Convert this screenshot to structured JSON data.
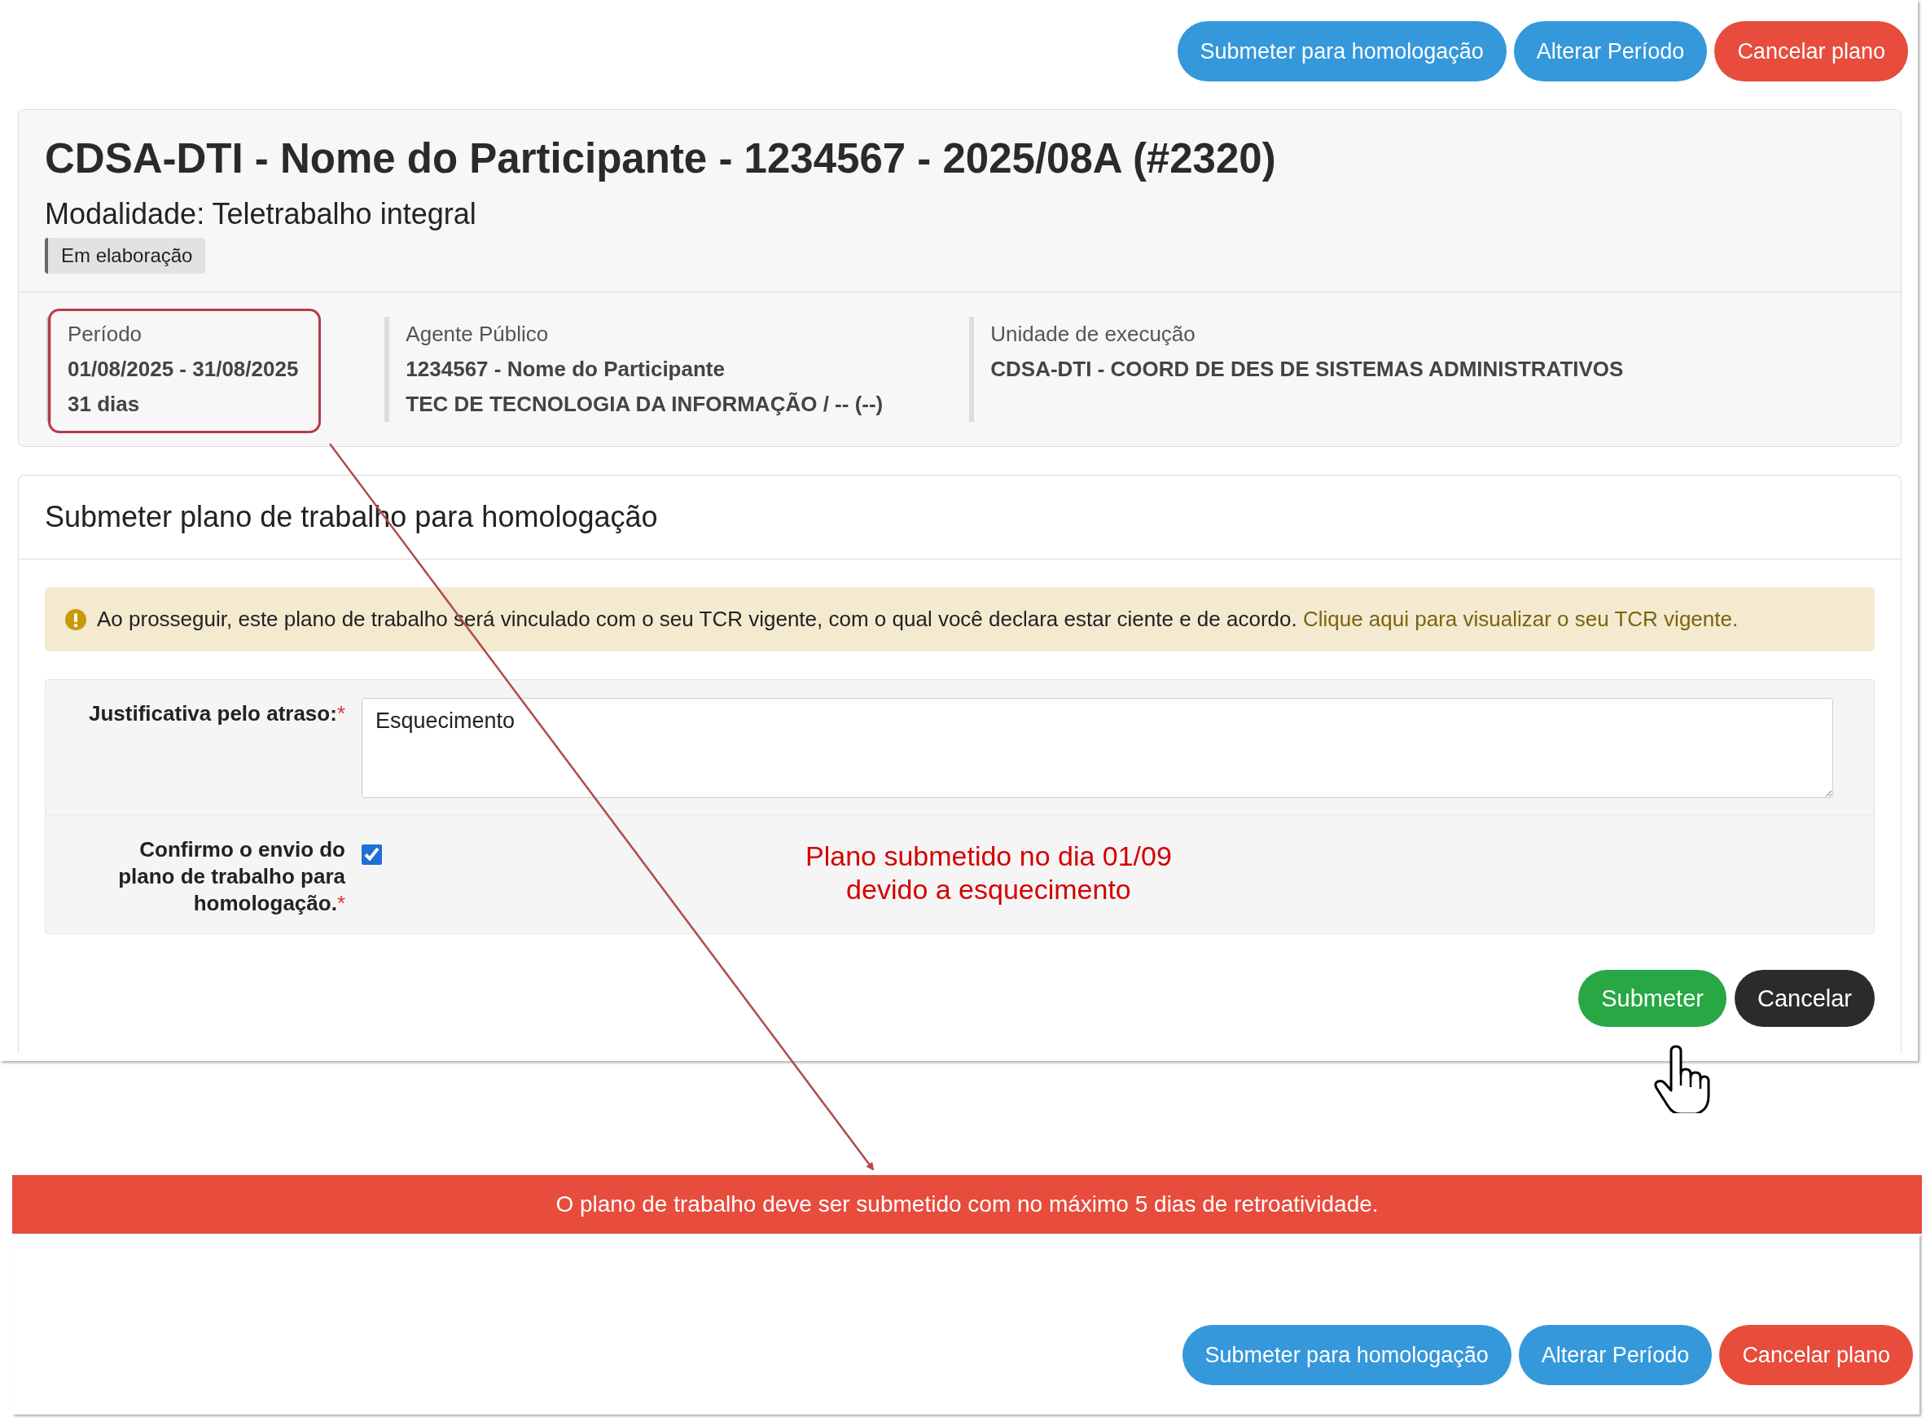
{
  "top_actions": [
    {
      "label": "Submeter para homologação",
      "kind": "primary"
    },
    {
      "label": "Alterar Período",
      "kind": "primary"
    },
    {
      "label": "Cancelar plano",
      "kind": "danger"
    }
  ],
  "plan": {
    "title": "CDSA-DTI - Nome do Participante - 1234567 - 2025/08A (#2320)",
    "modality": "Modalidade: Teletrabalho integral",
    "status": "Em elaboração",
    "details": [
      {
        "label": "Período",
        "lines": [
          "01/08/2025 - 31/08/2025",
          "31 dias"
        ],
        "highlighted": true
      },
      {
        "label": "Agente Público",
        "lines": [
          "1234567 - Nome do Participante",
          "TEC DE TECNOLOGIA DA INFORMAÇÃO / -- (--)"
        ],
        "highlighted": false
      },
      {
        "label": "Unidade de execução",
        "lines": [
          "CDSA-DTI - COORD DE DES DE SISTEMAS ADMINISTRATIVOS"
        ],
        "highlighted": false
      }
    ]
  },
  "submit_form": {
    "title": "Submeter plano de trabalho para homologação",
    "notice": {
      "text": "Ao prosseguir, este plano de trabalho será vinculado com o seu TCR vigente, com o qual você declara estar ciente e de acordo.",
      "link": "Clique aqui para visualizar o seu TCR vigente."
    },
    "justification": {
      "label": "Justificativa pelo atraso:",
      "required_mark": "*",
      "value": "Esquecimento"
    },
    "confirm": {
      "label": "Confirmo o envio do plano de trabalho para homologação.",
      "required_mark": "*",
      "checked": true
    },
    "buttons": [
      {
        "label": "Submeter",
        "kind": "success"
      },
      {
        "label": "Cancelar",
        "kind": "dark"
      }
    ]
  },
  "annotation": {
    "lines": [
      "Plano submetido no dia 01/09",
      "devido a esquecimento"
    ]
  },
  "error_banner": "O plano de trabalho deve ser submetido com no máximo 5 dias de retroatividade.",
  "bottom_actions": [
    {
      "label": "Submeter para homologação",
      "kind": "primary"
    },
    {
      "label": "Alterar Período",
      "kind": "primary"
    },
    {
      "label": "Cancelar plano",
      "kind": "danger"
    }
  ]
}
